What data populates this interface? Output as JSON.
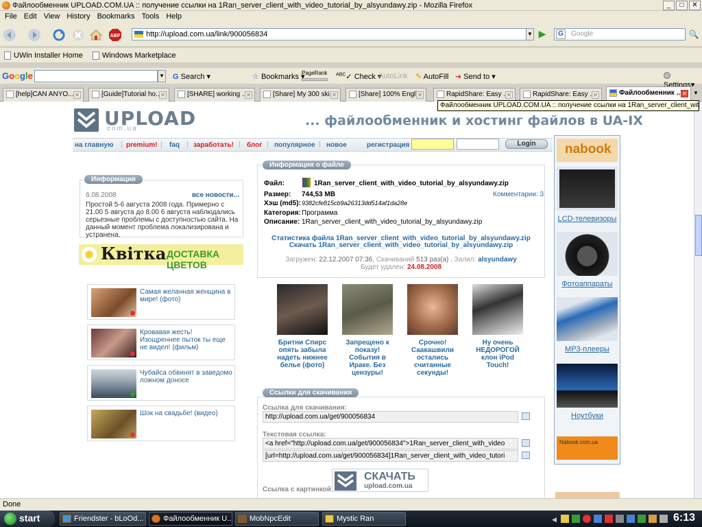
{
  "window": {
    "title": "Файлообменник UPLOAD.COM.UA :: получение ссылки на 1Ran_server_client_with_video_tutorial_by_alsyundawy.zip - Mozilla Firefox"
  },
  "menu": [
    "File",
    "Edit",
    "View",
    "History",
    "Bookmarks",
    "Tools",
    "Help"
  ],
  "nav": {
    "url": "http://upload.com.ua/link/900056834",
    "search_placeholder": "Google"
  },
  "bookmarks": [
    "UWin Installer Home",
    "Windows Marketplace"
  ],
  "gtoolbar": {
    "logo": "Google",
    "search_label": "Search",
    "bookmarks_label": "Bookmarks",
    "pagerank_label": "PageRank",
    "check_label": "Check",
    "autolink_label": "AutoLink",
    "autofill_label": "AutoFill",
    "sendto_label": "Send to",
    "settings_label": "Settings"
  },
  "tabs": [
    "[help]CAN ANYO...",
    "[Guide]Tutorial ho...",
    "[SHARE] working ...",
    "[Share] My 300 ski...",
    "[Share] 100% Engli...",
    "RapidShare: Easy ...",
    "RapidShare: Easy ...",
    "Файлообменник ..."
  ],
  "tooltip": "Файлообменник UPLOAD.COM.UA :: получение ссылки на 1Ran_server_client_with_video...",
  "page": {
    "logo_text": "UPLOAD",
    "logo_sub": "com.ua",
    "slogan": "... файлообменник и хостинг файлов в UA-IX",
    "sitenav": [
      {
        "label": "на главную",
        "red": false
      },
      {
        "label": "premium!",
        "red": true
      },
      {
        "label": "faq",
        "red": false
      },
      {
        "label": "заработать!",
        "red": true
      },
      {
        "label": "блог",
        "red": true
      },
      {
        "label": "популярное",
        "red": false
      },
      {
        "label": "новое",
        "red": false
      }
    ],
    "register_label": "регистрация",
    "login_label": "Login",
    "info": {
      "title": "Информация",
      "date": "6.08.2008",
      "all_news": "все новости...",
      "text": "Простой 5-6 августа 2008 года. Примерно с 21.00 5 августа до 8.00 6 августа наблюдались серьезные проблемы с доступностью сайта. На данный момент проблема локализирована и устранена."
    },
    "kvitka": {
      "brand": "Квітка",
      "tagline": "ДОСТАВКА ЦВЕТОВ"
    },
    "news_items": [
      "Самая желанная женщина в мире! (фото)",
      "Кровавая жесть! Изощреннее пыток ты еще не видел! (фильм)",
      "Чубайса обвинят в заведомо ложном доносе",
      "Шок на свадьбе! (видео)"
    ],
    "file": {
      "section_title": "Информация о файле",
      "file_label": "Файл:",
      "file_name": "1Ran_server_client_with_video_tutorial_by_alsyundawy.zip",
      "size_label": "Размер:",
      "size_value": "744,53 MB",
      "comments": "Комментарии: 3",
      "hash_label": "Хэш (md5):",
      "hash_value": "9382cfe815cb9a26313dd514af1da28e",
      "category_label": "Категория:",
      "category_value": "Программа",
      "desc_label": "Описание:",
      "desc_value": "1Ran_server_client_with_video_tutorial_by_alsyundawy.zip",
      "stats_link": "Статистика файла 1Ran_server_client_with_video_tutorial_by_alsyundawy.zip",
      "download_link": "Скачать 1Ran_server_client_with_video_tutorial_by_alsyundawy.zip",
      "uploaded_label": "Загружен:",
      "uploaded_value": "22.12.2007 07:36",
      "downloads_label": "Скачиваний",
      "downloads_value": "513 раз(а)",
      "user_label": "Залил:",
      "user_value": "alsyundawy",
      "delete_label": "Будет удален:",
      "delete_value": "24.08.2008"
    },
    "thumbs": [
      "Бритни Спирс опять забыла надеть нижнее белье (фото)",
      "Запрещено к показу! События в Ираке. Без цензуры!",
      "Срочно! Саакашвили остались считанные секунды!",
      "Ну очень НЕДОРОГОЙ клон iPod Touch!"
    ],
    "links": {
      "section_title": "Ссылки для скачивания",
      "dl_label": "Ссылка для скачивания:",
      "dl_value": "http://upload.com.ua/get/900056834",
      "text_label": "Текстовая ссылка:",
      "html_value": "<a href=\"http://upload.com.ua/get/900056834\">1Ran_server_client_with_video",
      "bb_value": "[url=http://upload.com.ua/get/900056834]1Ran_server_client_with_video_tutori",
      "img_label": "Ссылка с картинкой",
      "btn_main": "СКАЧАТЬ",
      "btn_sub": "upload.com.ua"
    },
    "ad": {
      "brand": "nabook",
      "items": [
        "LCD-телевизоры",
        "Фотоаппараты",
        "MP3-плееры",
        "Ноутбуки"
      ],
      "footer": "Nabook.com.ua"
    }
  },
  "status": "Done",
  "taskbar": {
    "start": "start",
    "tasks": [
      "Friendster - bLoOd...",
      "Файлообменник U...",
      "MobNpcEdit",
      "Mystic Ran"
    ],
    "clock": "6:13"
  }
}
